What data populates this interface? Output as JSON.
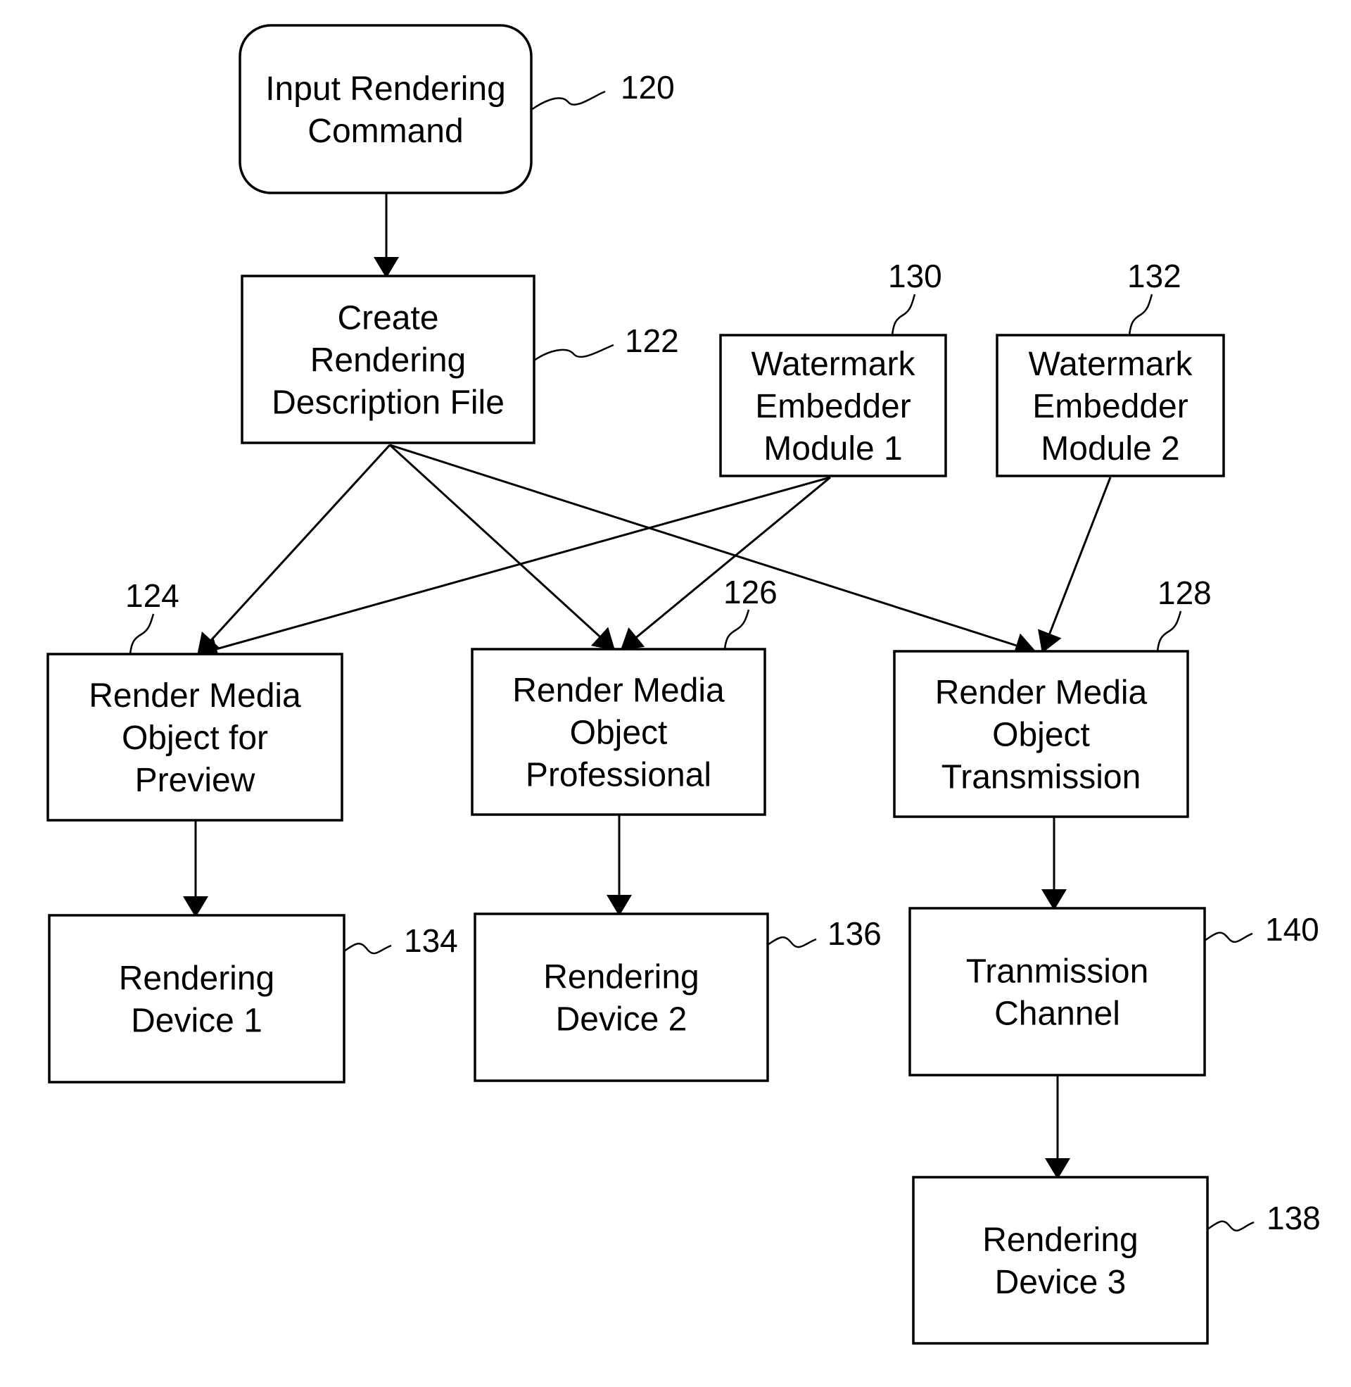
{
  "diagram": {
    "type": "flowchart",
    "nodes": [
      {
        "id": "120",
        "label_lines": [
          "Input Rendering",
          "Command"
        ],
        "ref": "120",
        "shape": "rounded"
      },
      {
        "id": "122",
        "label_lines": [
          "Create",
          "Rendering",
          "Description File"
        ],
        "ref": "122",
        "shape": "rect"
      },
      {
        "id": "130",
        "label_lines": [
          "Watermark",
          "Embedder",
          "Module 1"
        ],
        "ref": "130",
        "shape": "rect"
      },
      {
        "id": "132",
        "label_lines": [
          "Watermark",
          "Embedder",
          "Module 2"
        ],
        "ref": "132",
        "shape": "rect"
      },
      {
        "id": "124",
        "label_lines": [
          "Render Media",
          "Object for",
          "Preview"
        ],
        "ref": "124",
        "shape": "rect"
      },
      {
        "id": "126",
        "label_lines": [
          "Render Media",
          "Object",
          "Professional"
        ],
        "ref": "126",
        "shape": "rect"
      },
      {
        "id": "128",
        "label_lines": [
          "Render Media",
          "Object",
          "Transmission"
        ],
        "ref": "128",
        "shape": "rect"
      },
      {
        "id": "134",
        "label_lines": [
          "Rendering",
          "Device 1"
        ],
        "ref": "134",
        "shape": "rect"
      },
      {
        "id": "136",
        "label_lines": [
          "Rendering",
          "Device 2"
        ],
        "ref": "136",
        "shape": "rect"
      },
      {
        "id": "140",
        "label_lines": [
          "Tranmission",
          "Channel"
        ],
        "ref": "140",
        "shape": "rect"
      },
      {
        "id": "138",
        "label_lines": [
          "Rendering",
          "Device 3"
        ],
        "ref": "138",
        "shape": "rect"
      }
    ],
    "edges": [
      {
        "from": "120",
        "to": "122"
      },
      {
        "from": "122",
        "to": "124"
      },
      {
        "from": "122",
        "to": "126"
      },
      {
        "from": "122",
        "to": "128"
      },
      {
        "from": "130",
        "to": "124"
      },
      {
        "from": "130",
        "to": "126"
      },
      {
        "from": "132",
        "to": "128"
      },
      {
        "from": "124",
        "to": "134"
      },
      {
        "from": "126",
        "to": "136"
      },
      {
        "from": "128",
        "to": "140"
      },
      {
        "from": "140",
        "to": "138"
      }
    ]
  }
}
